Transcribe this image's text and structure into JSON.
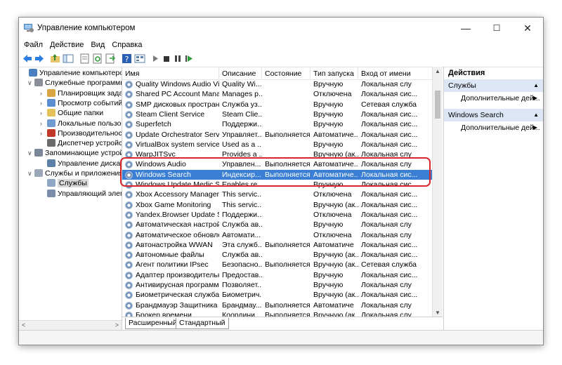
{
  "window": {
    "title": "Управление компьютером",
    "minimize": "—",
    "maximize": "☐",
    "close": "✕"
  },
  "menu": [
    "Файл",
    "Действие",
    "Вид",
    "Справка"
  ],
  "toolbar_icons": [
    "back-icon",
    "forward-icon",
    "up-folder-icon",
    "console-tree-icon",
    "properties-icon",
    "refresh-icon",
    "export-icon",
    "help-icon",
    "view-icon",
    "play-icon",
    "stop-icon",
    "pause-icon",
    "restart-icon"
  ],
  "tree": [
    {
      "label": "Управление компьютером (л",
      "exp": "",
      "level": 0,
      "icon": "computer-icon"
    },
    {
      "label": "Служебные программы",
      "exp": "∨",
      "level": 1,
      "icon": "tools-icon"
    },
    {
      "label": "Планировщик заданий",
      "exp": "›",
      "level": 2,
      "icon": "clock-icon"
    },
    {
      "label": "Просмотр событий",
      "exp": "›",
      "level": 2,
      "icon": "event-viewer-icon"
    },
    {
      "label": "Общие папки",
      "exp": "›",
      "level": 2,
      "icon": "shared-folder-icon"
    },
    {
      "label": "Локальные пользовате",
      "exp": "›",
      "level": 2,
      "icon": "users-icon"
    },
    {
      "label": "Производительность",
      "exp": "›",
      "level": 2,
      "icon": "performance-icon"
    },
    {
      "label": "Диспетчер устройств",
      "exp": "",
      "level": 2,
      "icon": "device-manager-icon"
    },
    {
      "label": "Запоминающие устройст",
      "exp": "∨",
      "level": 1,
      "icon": "storage-icon"
    },
    {
      "label": "Управление дисками",
      "exp": "",
      "level": 2,
      "icon": "disk-icon"
    },
    {
      "label": "Службы и приложения",
      "exp": "∨",
      "level": 1,
      "icon": "services-apps-icon"
    },
    {
      "label": "Службы",
      "exp": "",
      "level": 2,
      "icon": "services-icon",
      "selected": true
    },
    {
      "label": "Управляющий элемен",
      "exp": "",
      "level": 2,
      "icon": "wmi-icon"
    }
  ],
  "list": {
    "columns": [
      "Имя",
      "Описание",
      "Состояние",
      "Тип запуска",
      "Вход от имени"
    ],
    "rows": [
      [
        "Quality Windows Audio Vid...",
        "Quality Wi...",
        "",
        "Вручную",
        "Локальная слу"
      ],
      [
        "Shared PC Account Manager",
        "Manages p...",
        "",
        "Отключена",
        "Локальная сис..."
      ],
      [
        "SMP дисковых пространст...",
        "Служба уз...",
        "",
        "Вручную",
        "Сетевая служба"
      ],
      [
        "Steam Client Service",
        "Steam Clie...",
        "",
        "Вручную",
        "Локальная сис..."
      ],
      [
        "Superfetch",
        "Поддержи...",
        "",
        "Вручную",
        "Локальная сис..."
      ],
      [
        "Update Orchestrator Service",
        "Управляет...",
        "Выполняется",
        "Автоматиче...",
        "Локальная сис..."
      ],
      [
        "VirtualBox system service",
        "Used as a ...",
        "",
        "Вручную",
        "Локальная сис..."
      ],
      [
        "WarpJITSvc",
        "Provides a ...",
        "",
        "Вручную (ак...",
        "Локальная слу"
      ],
      [
        "Windows Audio",
        "Управлен...",
        "Выполняется",
        "Автоматиче...",
        "Локальная слу"
      ],
      [
        "Windows Search",
        "Индексир...",
        "Выполняется",
        "Автоматиче...",
        "Локальная сис..."
      ],
      [
        "Windows Update Medic Ser...",
        "Enables re...",
        "",
        "Вручную",
        "Локальная сис..."
      ],
      [
        "Xbox Accessory Manageme...",
        "This servic...",
        "",
        "Отключена",
        "Локальная сис..."
      ],
      [
        "Xbox Game Monitoring",
        "This servic...",
        "",
        "Вручную (ак...",
        "Локальная сис..."
      ],
      [
        "Yandex.Browser Update Ser...",
        "Поддержи...",
        "",
        "Отключена",
        "Локальная сис..."
      ],
      [
        "Автоматическая настройк...",
        "Служба ав...",
        "",
        "Вручную",
        "Локальная слу"
      ],
      [
        "Автоматическое обновле...",
        "Автомати...",
        "",
        "Отключена",
        "Локальная слу"
      ],
      [
        "Автонастройка WWAN",
        "Эта служб...",
        "Выполняется",
        "Автоматиче",
        "Локальная сис..."
      ],
      [
        "Автономные файлы",
        "Служба ав...",
        "",
        "Вручную (ак...",
        "Локальная сис..."
      ],
      [
        "Агент политики IPsec",
        "Безопасно...",
        "Выполняется",
        "Вручную (ак...",
        "Сетевая служба"
      ],
      [
        "Адаптер производительно...",
        "Предостав...",
        "",
        "Вручную",
        "Локальная сис..."
      ],
      [
        "Антивирусная программа ...",
        "Позволяет...",
        "",
        "Вручную",
        "Локальная слу"
      ],
      [
        "Биометрическая служба ...",
        "Биометрич...",
        "",
        "Вручную (ак...",
        "Локальная сис..."
      ],
      [
        "Брандмауэр Защитника W...",
        "Брандмау...",
        "Выполняется",
        "Автоматиче",
        "Локальная слу"
      ],
      [
        "Брокер времени",
        "Координи...",
        "Выполняется",
        "Вручную (ак...",
        "Локальная слу"
      ]
    ],
    "selected_index": 9,
    "sort_arrow": "^"
  },
  "tabs": [
    "Расширенный",
    "Стандартный"
  ],
  "actions": {
    "title": "Действия",
    "sections": [
      {
        "label": "Службы",
        "item": "Дополнительные дей..."
      },
      {
        "label": "Windows Search",
        "item": "Дополнительные дей..."
      }
    ]
  },
  "colors": {
    "selection": "#3a7fd3",
    "highlight_box": "#d9262c",
    "action_section": "#dce6f4"
  }
}
